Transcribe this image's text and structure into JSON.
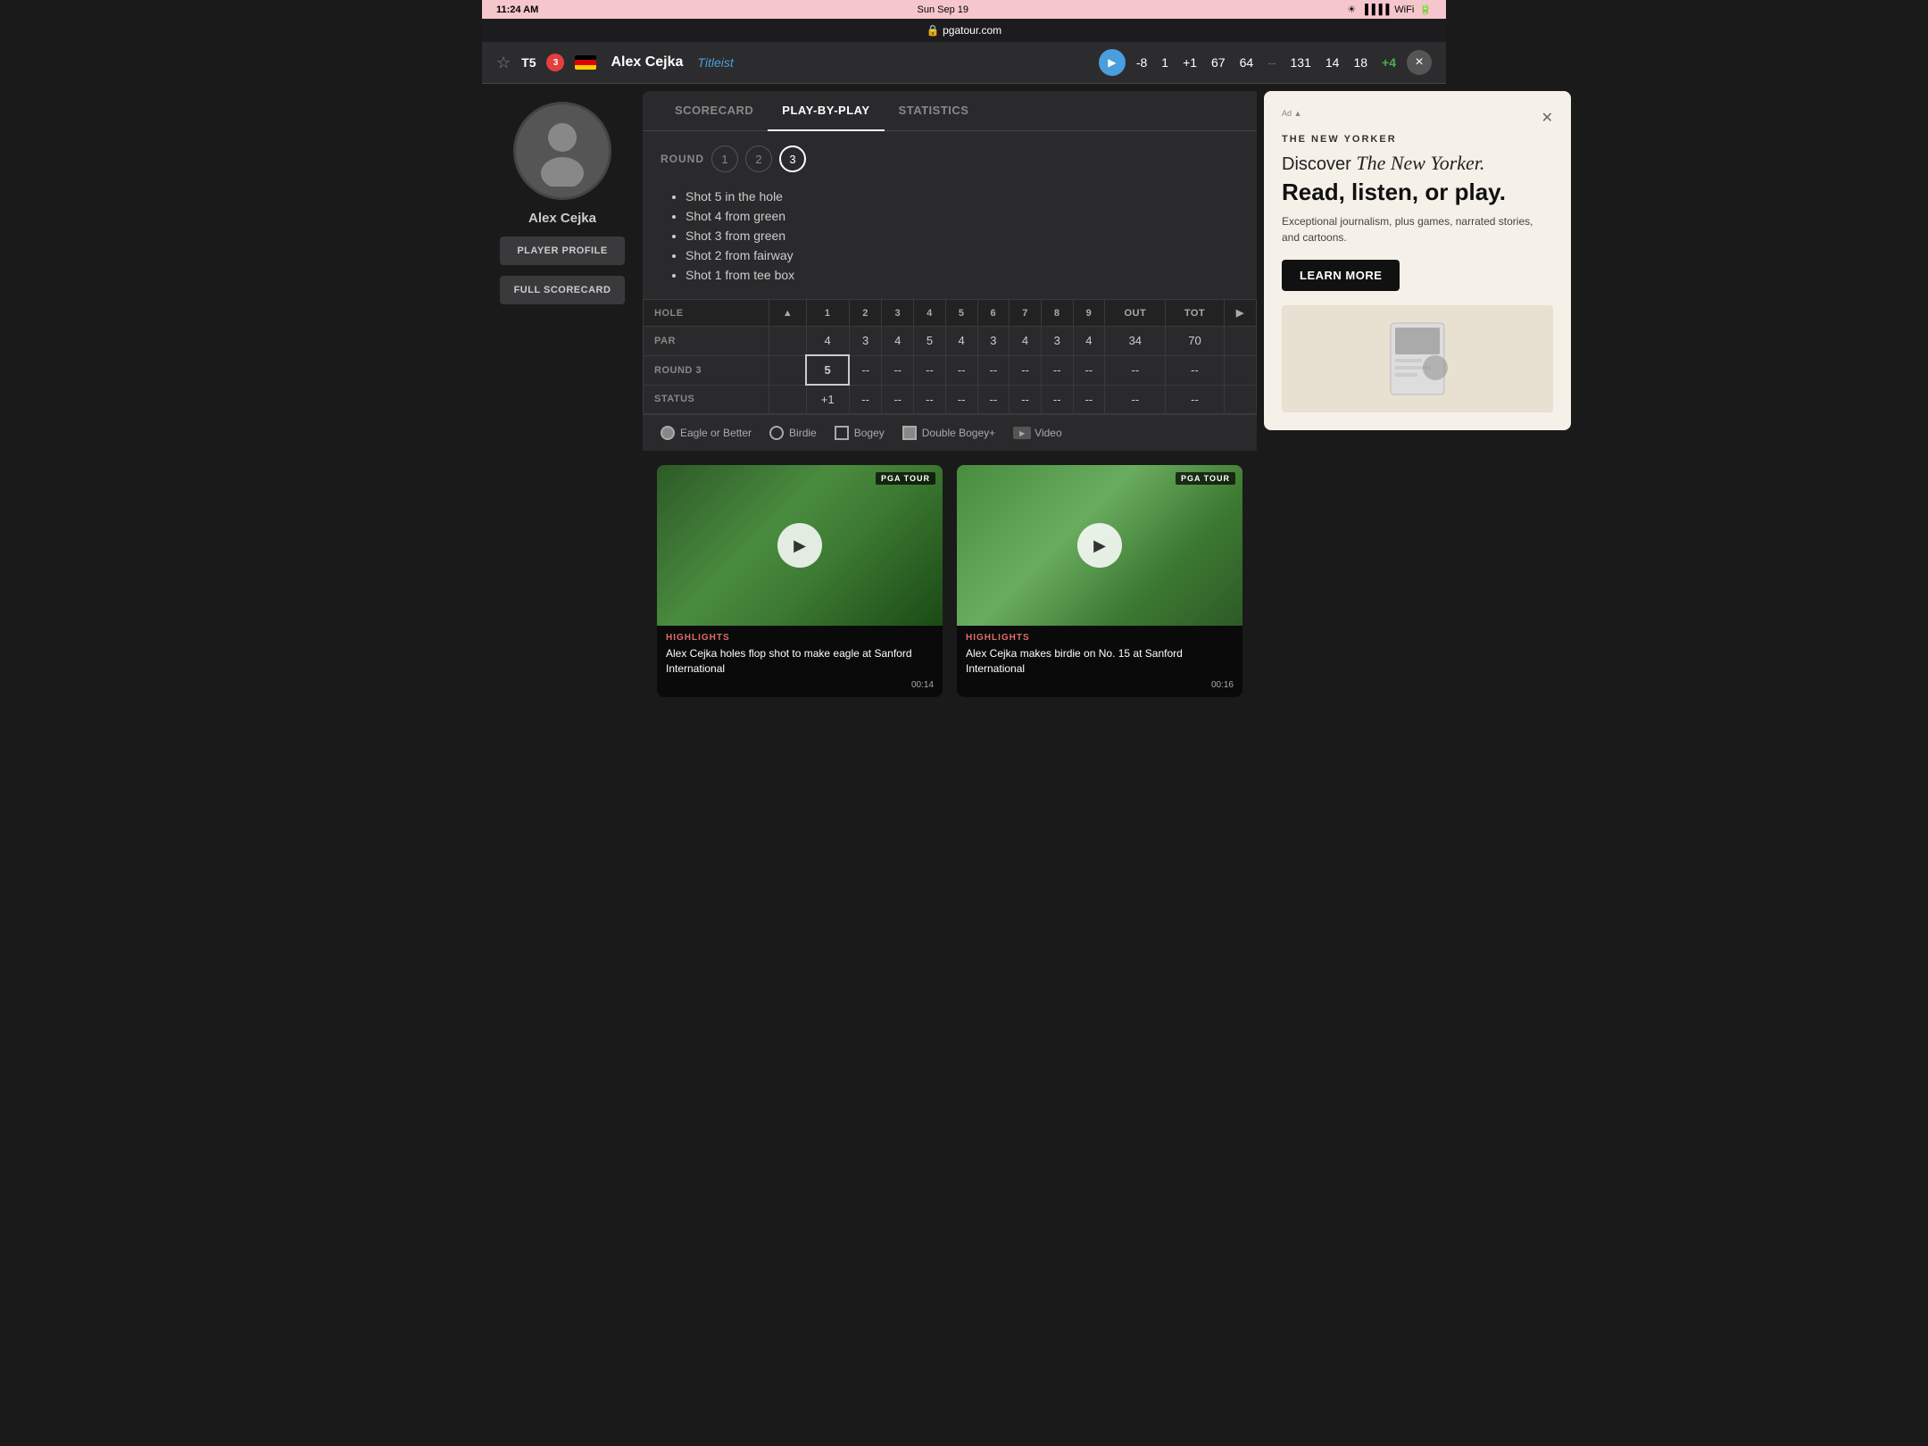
{
  "statusBar": {
    "time": "11:24 AM",
    "date": "Sun Sep 19",
    "url": "pgatour.com"
  },
  "header": {
    "position": "T5",
    "badge": "3",
    "playerName": "Alex Cejka",
    "brand": "Titleist",
    "score": "-8",
    "round1": "1",
    "round2": "+1",
    "round3": "67",
    "round4": "64",
    "sep": "--",
    "total": "131",
    "thru1": "14",
    "thru2": "18",
    "greenScore": "+4",
    "closeBtnLabel": "×"
  },
  "sidebar": {
    "playerName": "Alex Cejka",
    "profileBtnLabel": "PLAYER PROFILE",
    "scorecardBtnLabel": "FULL SCORECARD"
  },
  "tabs": [
    {
      "id": "scorecard",
      "label": "SCORECARD"
    },
    {
      "id": "play-by-play",
      "label": "PLAY-BY-PLAY"
    },
    {
      "id": "statistics",
      "label": "STATISTICS"
    }
  ],
  "activeTab": "play-by-play",
  "roundSelector": {
    "label": "ROUND",
    "rounds": [
      "1",
      "2",
      "3"
    ],
    "active": 3
  },
  "shotList": {
    "items": [
      "Shot 5 in the hole",
      "Shot 4 from green",
      "Shot 3 from green",
      "Shot 2 from fairway",
      "Shot 1 from tee box"
    ]
  },
  "scorecard": {
    "headers": [
      "HOLE",
      "1",
      "2",
      "3",
      "4",
      "5",
      "6",
      "7",
      "8",
      "9",
      "OUT",
      "TOT"
    ],
    "par": [
      "PAR",
      "4",
      "3",
      "4",
      "5",
      "4",
      "3",
      "4",
      "3",
      "4",
      "34",
      "70"
    ],
    "round3": [
      "ROUND 3",
      "5",
      "--",
      "--",
      "--",
      "--",
      "--",
      "--",
      "--",
      "--",
      "--",
      "--"
    ],
    "status": [
      "STATUS",
      "+1",
      "--",
      "--",
      "--",
      "--",
      "--",
      "--",
      "--",
      "--",
      "--",
      "--"
    ]
  },
  "legend": [
    {
      "type": "circle-filled",
      "label": "Eagle or Better"
    },
    {
      "type": "circle-empty",
      "label": "Birdie"
    },
    {
      "type": "square-empty",
      "label": "Bogey"
    },
    {
      "type": "square-filled",
      "label": "Double Bogey+"
    },
    {
      "type": "video",
      "label": "Video"
    }
  ],
  "ad": {
    "publication": "THE NEW YORKER",
    "headlinePart1": "Discover ",
    "headlinePart2": "The New Yorker.",
    "headlinePart3": "Read, listen, or play.",
    "body": "Exceptional journalism, plus games, narrated stories, and cartoons.",
    "ctaLabel": "LEARN MORE"
  },
  "videos": [
    {
      "badge": "PGA TOUR",
      "tag": "HIGHLIGHTS",
      "title": "Alex Cejka holes flop shot to make eagle at Sanford International",
      "duration": "00:14"
    },
    {
      "badge": "PGA TOUR",
      "tag": "HIGHLIGHTS",
      "title": "Alex Cejka makes birdie on No. 15 at Sanford International",
      "duration": "00:16"
    }
  ]
}
